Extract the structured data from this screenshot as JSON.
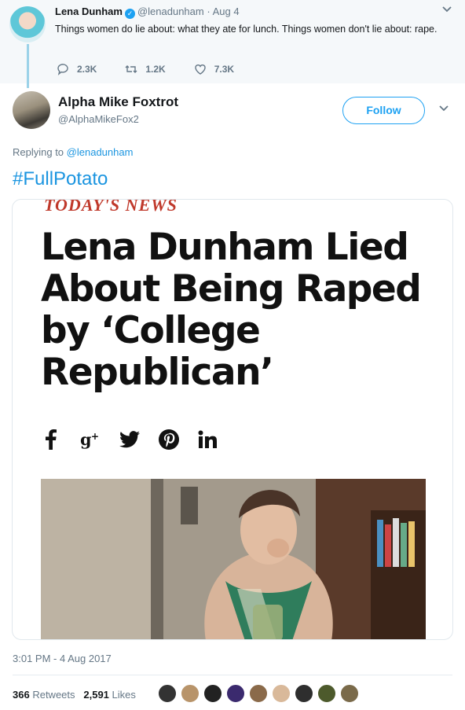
{
  "parent_tweet": {
    "name": "Lena Dunham",
    "handle": "@lenadunham",
    "date": "Aug 4",
    "text": "Things women do lie about: what they ate for lunch. Things women don't lie about: rape.",
    "replies": "2.3K",
    "retweets": "1.2K",
    "likes": "7.3K"
  },
  "tweet": {
    "name": "Alpha Mike Foxtrot",
    "handle": "@AlphaMikeFox2",
    "follow_label": "Follow",
    "replying_prefix": "Replying to",
    "replying_to": "@lenadunham",
    "text": "#FullPotato",
    "timestamp": "3:01 PM - 4 Aug 2017",
    "retweet_count": "366",
    "retweet_label": "Retweets",
    "like_count": "2,591",
    "like_label": "Likes"
  },
  "card": {
    "brand": "TODAY'S NEWS",
    "headline": "Lena Dunham Lied About Being Raped by ‘College Republican’",
    "share_icons": [
      "facebook-icon",
      "google-plus-icon",
      "twitter-icon",
      "pinterest-icon",
      "linkedin-icon"
    ]
  },
  "colors": {
    "accent": "#1da1f2",
    "link": "#1b95e0",
    "muted": "#657786",
    "brand_red": "#c0392b"
  }
}
